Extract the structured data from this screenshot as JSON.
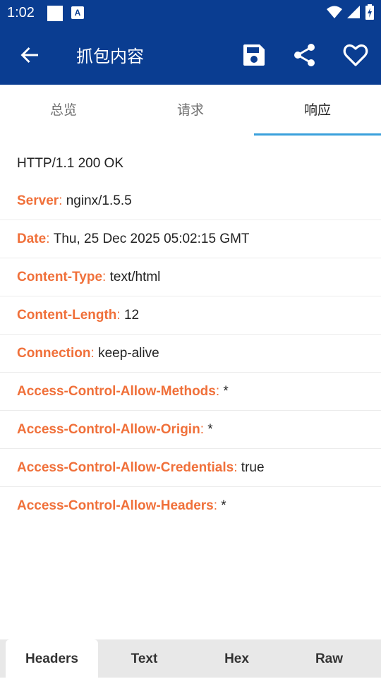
{
  "status_bar": {
    "time": "1:02",
    "notif_icon_letter": "A"
  },
  "app_bar": {
    "title": "抓包内容"
  },
  "tabs": [
    {
      "label": "总览"
    },
    {
      "label": "请求"
    },
    {
      "label": "响应",
      "active": true
    }
  ],
  "response": {
    "status_line": "HTTP/1.1 200 OK",
    "headers": [
      {
        "key": "Server",
        "value": "nginx/1.5.5"
      },
      {
        "key": "Date",
        "value": "Thu, 25 Dec 2025 05:02:15 GMT"
      },
      {
        "key": "Content-Type",
        "value": "text/html"
      },
      {
        "key": "Content-Length",
        "value": "12"
      },
      {
        "key": "Connection",
        "value": "keep-alive"
      },
      {
        "key": "Access-Control-Allow-Methods",
        "value": "*"
      },
      {
        "key": "Access-Control-Allow-Origin",
        "value": "*"
      },
      {
        "key": "Access-Control-Allow-Credentials",
        "value": "true"
      },
      {
        "key": "Access-Control-Allow-Headers",
        "value": "*"
      }
    ],
    "separator": ":"
  },
  "bottom_tabs": [
    {
      "label": "Headers",
      "active": true
    },
    {
      "label": "Text"
    },
    {
      "label": "Hex"
    },
    {
      "label": "Raw"
    }
  ],
  "colors": {
    "app_bar": "#0a3d91",
    "header_key": "#f0703a",
    "tab_indicator": "#3aa0dc"
  },
  "icons": {
    "back": "arrow-left-icon",
    "save": "save-icon",
    "share": "share-icon",
    "favorite": "heart-icon"
  }
}
